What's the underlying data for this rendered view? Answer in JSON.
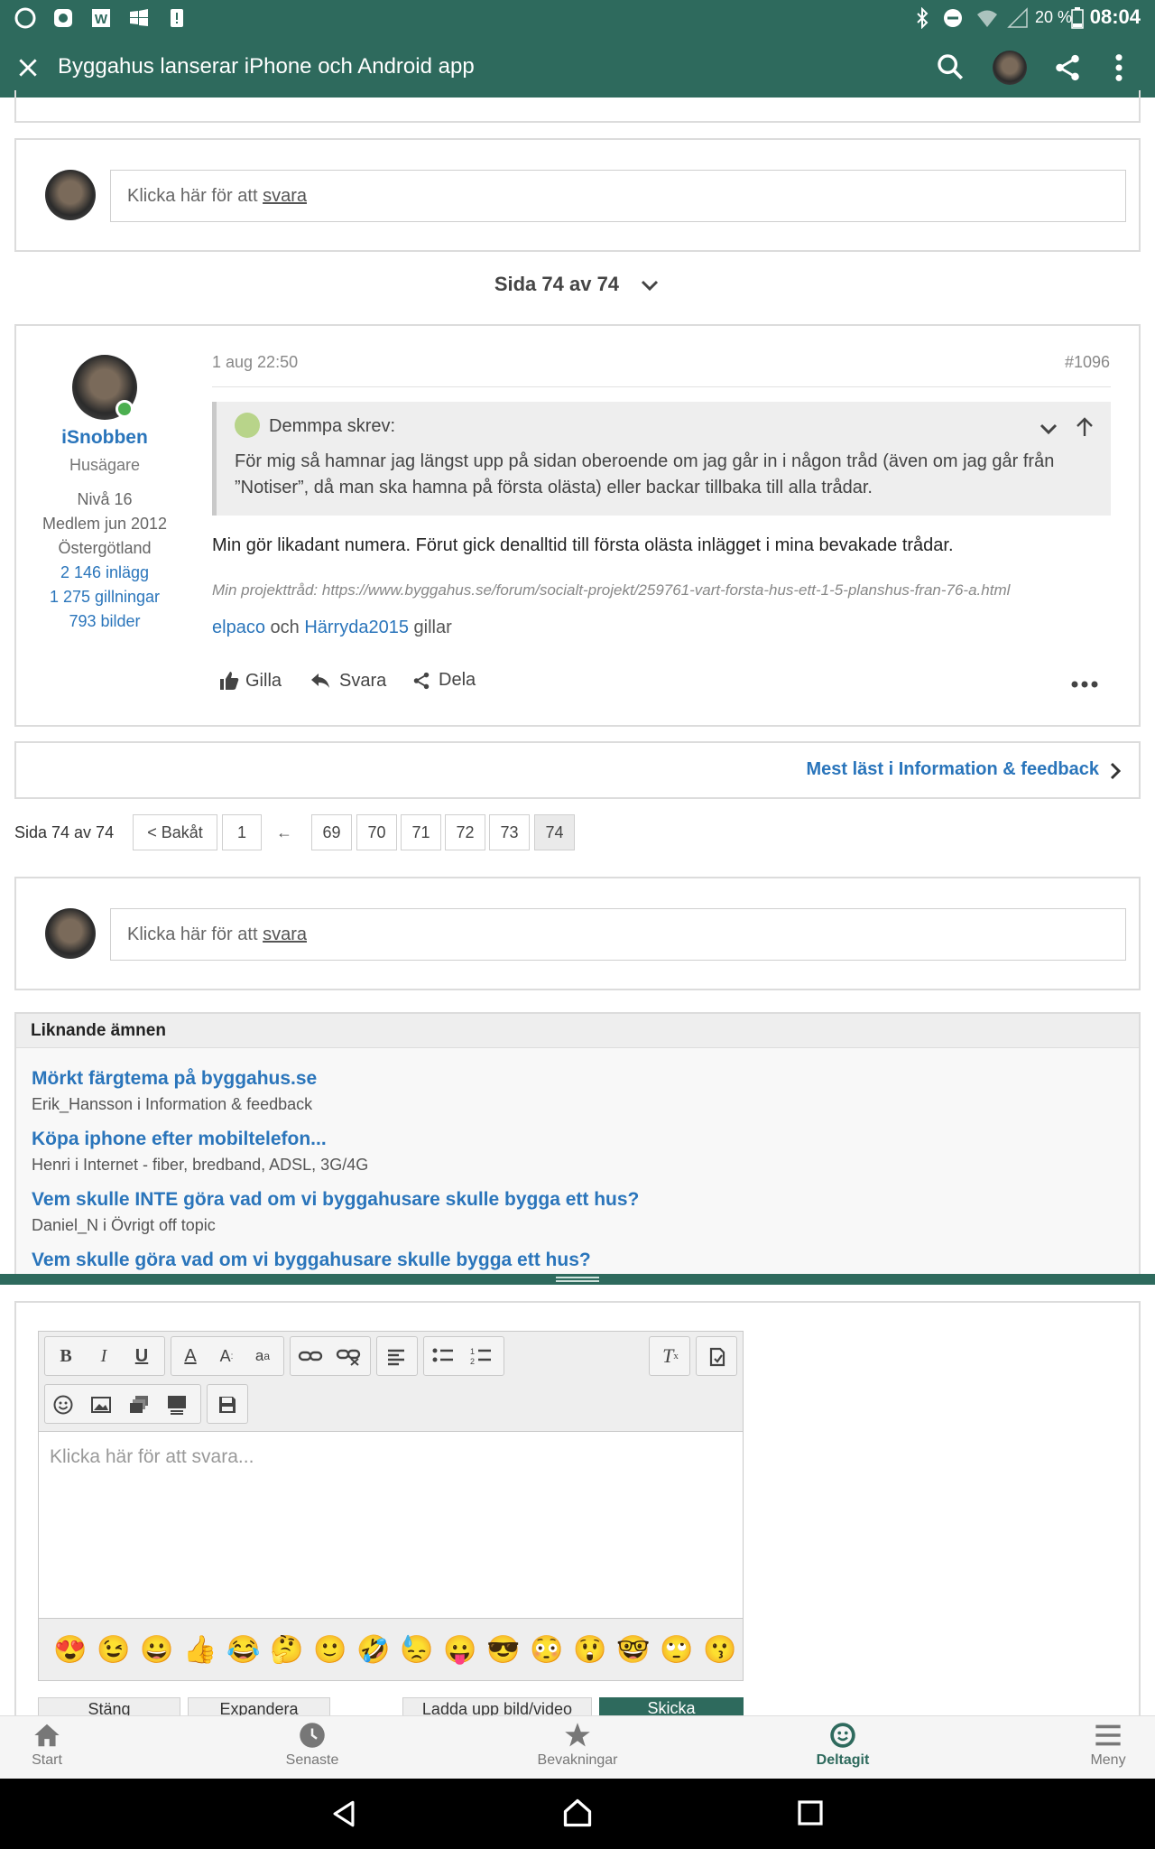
{
  "status_bar": {
    "battery_pct": "20 %",
    "time": "08:04"
  },
  "app_bar": {
    "title": "Byggahus lanserar iPhone och Android app"
  },
  "reply_top": {
    "prefix": "Klicka här för att ",
    "link": "svara"
  },
  "page_header": {
    "label": "Sida 74 av 74"
  },
  "post": {
    "date": "1 aug 22:50",
    "number": "#1096",
    "author": "iSnobben",
    "role": "Husägare",
    "level": "Nivå 16",
    "member_since": "Medlem jun 2012",
    "location": "Östergötland",
    "posts": "2 146 inlägg",
    "likes": "1 275 gillningar",
    "images": "793 bilder",
    "quote_author": "Demmpa skrev:",
    "quote_text": "För mig så hamnar jag längst upp på sidan oberoende om jag går in i någon tråd (även om jag går från ”Notiser”, då man ska hamna på första olästa) eller backar tillbaka till alla trådar.",
    "body": "Min gör likadant numera. Förut gick denalltid till första olästa inlägget i mina bevakade trådar.",
    "signature": "Min projekttråd: https://www.byggahus.se/forum/socialt-projekt/259761-vart-forsta-hus-ett-1-5-planshus-fran-76-a.html",
    "likers": {
      "user1": "elpaco",
      "and": "och",
      "user2": "Härryda2015",
      "suffix": "gillar"
    },
    "actions": {
      "like": "Gilla",
      "reply": "Svara",
      "share": "Dela"
    }
  },
  "most_read": {
    "label": "Mest läst i Information & feedback"
  },
  "pagination": {
    "label": "Sida 74 av 74",
    "back": "< Bakåt",
    "first": "1",
    "ellipsis": "←",
    "pages": [
      "69",
      "70",
      "71",
      "72",
      "73",
      "74"
    ],
    "current": "74"
  },
  "reply_bottom": {
    "prefix": "Klicka här för att ",
    "link": "svara"
  },
  "related": {
    "heading": "Liknande ämnen",
    "items": [
      {
        "title": "Mörkt färgtema på byggahus.se",
        "meta": "Erik_Hansson i Information & feedback"
      },
      {
        "title": "Köpa iphone efter mobiltelefon...",
        "meta": "Henri i Internet - fiber, bredband, ADSL, 3G/4G"
      },
      {
        "title": "Vem skulle INTE göra vad om vi byggahusare skulle bygga ett hus?",
        "meta": "Daniel_N i Övrigt off topic"
      },
      {
        "title": "Vem skulle göra vad om vi byggahusare skulle bygga ett hus?",
        "meta": ""
      }
    ]
  },
  "editor": {
    "placeholder": "Klicka här för att svara...",
    "emojis": [
      "😍",
      "😉",
      "😀",
      "👍",
      "😂",
      "🤔",
      "🙂",
      "🤣",
      "😓",
      "😛",
      "😎",
      "😳",
      "😲",
      "🤓",
      "🙄",
      "😗"
    ],
    "buttons": {
      "close": "Stäng",
      "expand": "Expandera",
      "upload": "Ladda upp bild/video",
      "send": "Skicka"
    }
  },
  "bottom_nav": [
    {
      "label": "Start",
      "icon": "home-icon"
    },
    {
      "label": "Senaste",
      "icon": "clock-icon"
    },
    {
      "label": "Bevakningar",
      "icon": "star-icon"
    },
    {
      "label": "Deltagit",
      "icon": "smiley-icon"
    },
    {
      "label": "Meny",
      "icon": "menu-icon"
    }
  ],
  "colors": {
    "brand": "#2e6a5d",
    "link": "#2a75bb",
    "online": "#4caf50"
  }
}
